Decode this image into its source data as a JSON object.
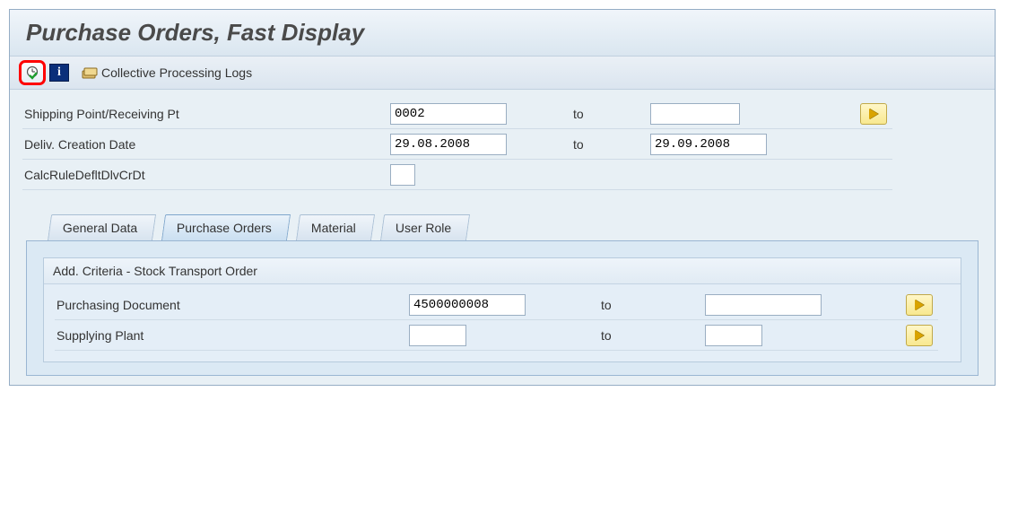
{
  "title": "Purchase Orders, Fast Display",
  "toolbar": {
    "collective_logs_label": "Collective Processing Logs"
  },
  "selection": {
    "shipping_point": {
      "label": "Shipping Point/Receiving Pt",
      "from": "0002",
      "to_label": "to",
      "to": ""
    },
    "deliv_creation_date": {
      "label": "Deliv. Creation Date",
      "from": "29.08.2008",
      "to_label": "to",
      "to": "29.09.2008"
    },
    "calc_rule": {
      "label": "CalcRuleDefltDlvCrDt",
      "value": ""
    }
  },
  "tabs": {
    "general_data": "General Data",
    "purchase_orders": "Purchase Orders",
    "material": "Material",
    "user_role": "User Role"
  },
  "po_group": {
    "title": "Add. Criteria - Stock Transport Order",
    "purchasing_document": {
      "label": "Purchasing Document",
      "from": "4500000008",
      "to_label": "to",
      "to": ""
    },
    "supplying_plant": {
      "label": "Supplying Plant",
      "from": "",
      "to_label": "to",
      "to": ""
    }
  }
}
